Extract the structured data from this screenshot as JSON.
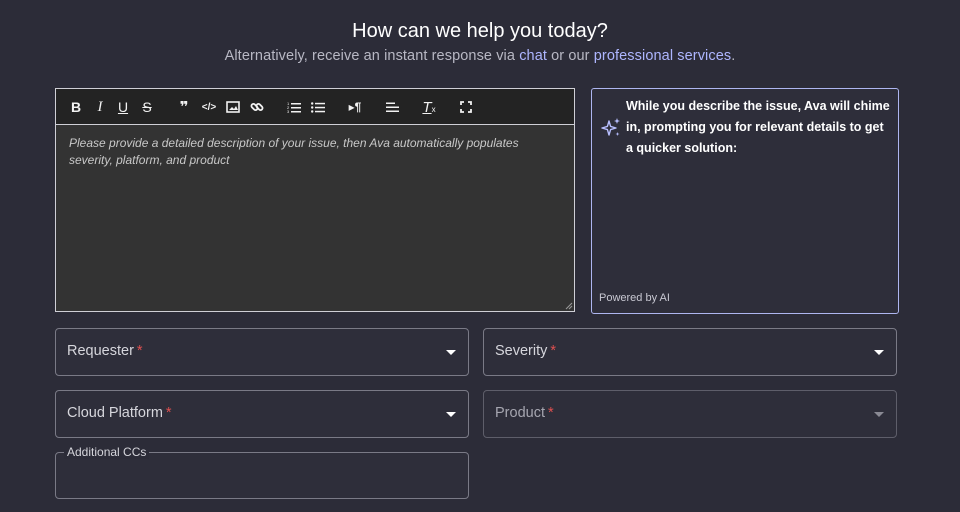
{
  "header": {
    "title": "How can we help you today?",
    "subtitle_prefix": "Alternatively, receive an instant response via ",
    "chat_link": "chat",
    "subtitle_middle": " or our ",
    "services_link": "professional services",
    "subtitle_suffix": "."
  },
  "editor": {
    "toolbar": [
      {
        "name": "bold-button",
        "icon": "bold-icon",
        "glyph": "B"
      },
      {
        "name": "italic-button",
        "icon": "italic-icon",
        "glyph": "I"
      },
      {
        "name": "underline-button",
        "icon": "underline-icon",
        "glyph": "U"
      },
      {
        "name": "strikethrough-button",
        "icon": "strikethrough-icon",
        "glyph": "S"
      },
      {
        "name": "quote-button",
        "icon": "quote-icon",
        "glyph": "❞"
      },
      {
        "name": "code-button",
        "icon": "code-icon",
        "glyph": "</>"
      },
      {
        "name": "image-button",
        "icon": "image-icon",
        "glyph": ""
      },
      {
        "name": "link-button",
        "icon": "link-icon",
        "glyph": ""
      },
      {
        "name": "ordered-list-button",
        "icon": "ordered-list-icon",
        "glyph": ""
      },
      {
        "name": "bullet-list-button",
        "icon": "bullet-list-icon",
        "glyph": ""
      },
      {
        "name": "paragraph-button",
        "icon": "paragraph-icon",
        "glyph": "▸¶"
      },
      {
        "name": "align-button",
        "icon": "align-left-icon",
        "glyph": ""
      },
      {
        "name": "clear-format-button",
        "icon": "clear-format-icon",
        "glyph": "T"
      },
      {
        "name": "fullscreen-button",
        "icon": "fullscreen-icon",
        "glyph": ""
      }
    ],
    "placeholder": "Please provide a detailed description of your issue, then Ava automatically populates severity, platform, and product"
  },
  "ai_panel": {
    "message": "While you describe the issue, Ava will chime in, prompting you for relevant details to get a quicker solution:",
    "powered_by": "Powered by AI",
    "accent_color": "#aeb6f0"
  },
  "fields": {
    "requester": {
      "label": "Requester",
      "required_mark": "*"
    },
    "severity": {
      "label": "Severity",
      "required_mark": "*"
    },
    "cloud_platform": {
      "label": "Cloud Platform",
      "required_mark": "*"
    },
    "product": {
      "label": "Product",
      "required_mark": "*"
    },
    "additional_ccs": {
      "label": "Additional CCs",
      "value": ""
    }
  },
  "colors": {
    "background": "#2c2c38",
    "link": "#aeb6ff",
    "required": "#e05050"
  }
}
